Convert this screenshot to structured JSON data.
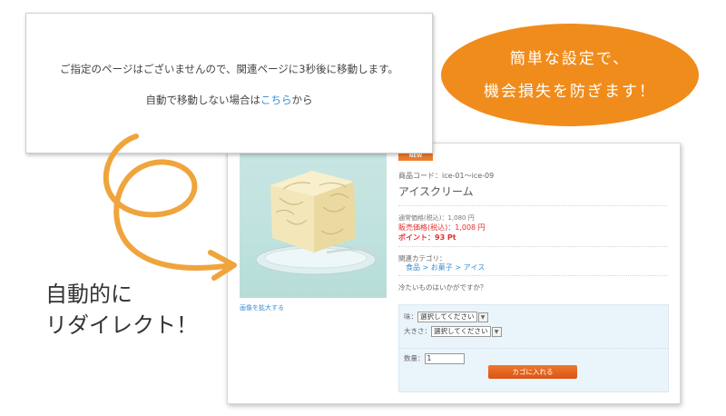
{
  "notice": {
    "line1": "ご指定のページはございませんので、関連ページに3秒後に移動します。",
    "line2_prefix": "自動で移動しない場合は",
    "line2_link": "こちら",
    "line2_suffix": "から"
  },
  "bubble": {
    "line1": "簡単な設定で、",
    "line2": "機会損失を防ぎます！"
  },
  "side_label": {
    "line1": "自動的に",
    "line2": "リダイレクト！"
  },
  "product": {
    "badge": "NEW",
    "code": "商品コード：ice-01～ice-09",
    "name": "アイスクリーム",
    "regular_price": "通常価格(税込)：1,080 円",
    "sale_price": "販売価格(税込)：1,008 円",
    "points": "ポイント：93 Pt",
    "category_label": "関連カテゴリ：",
    "category_path": [
      "食品",
      "お菓子",
      "アイス"
    ],
    "category_separator": ">",
    "tagline": "冷たいものはいかがですか？",
    "zoom_link": "画像を拡大する"
  },
  "options": {
    "flavor_label": "味：",
    "flavor_value": "選択してください",
    "size_label": "大きさ：",
    "size_value": "選択してください",
    "qty_label": "数量：",
    "qty_value": "1",
    "cart_button": "カゴに入れる"
  },
  "colors": {
    "accent_orange": "#f08c1c",
    "link_blue": "#3b8fd6",
    "price_red": "#e23030",
    "options_bg": "#eaf4fb"
  }
}
